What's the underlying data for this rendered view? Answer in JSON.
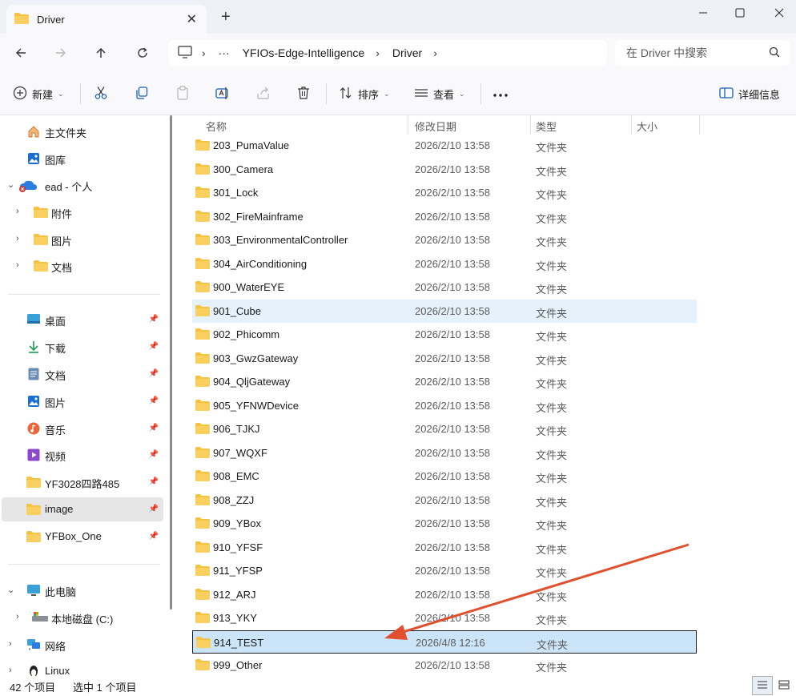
{
  "window": {
    "tab_title": "Driver",
    "colors": {
      "accent": "#0067c0",
      "folder": "#f5c242",
      "selected_row": "#cce4f7",
      "annotation_arrow": "#e0502e"
    }
  },
  "address": {
    "crumbs": [
      "YFIOs-Edge-Intelligence",
      "Driver"
    ],
    "search_placeholder": "在 Driver 中搜索"
  },
  "toolbar": {
    "new_label": "新建",
    "sort_label": "排序",
    "view_label": "查看",
    "details_label": "详细信息"
  },
  "sidebar": {
    "home": "主文件夹",
    "gallery": "图库",
    "onedrive": "ead - 个人",
    "od_attachments": "附件",
    "od_pictures": "图片",
    "od_documents": "文档",
    "desktop": "桌面",
    "downloads": "下载",
    "documents": "文档",
    "pictures": "图片",
    "music": "音乐",
    "videos": "视频",
    "pinned1": "YF3028四路485",
    "pinned2": "image",
    "pinned3": "YFBox_One",
    "thispc": "此电脑",
    "localdisk": "本地磁盘 (C:)",
    "network": "网络",
    "linux": "Linux"
  },
  "columns": {
    "name": "名称",
    "modified": "修改日期",
    "type": "类型",
    "size": "大小"
  },
  "files": [
    {
      "name": "203_PumaValue",
      "date": "2026/2/10 13:58",
      "type": "文件夹"
    },
    {
      "name": "300_Camera",
      "date": "2026/2/10 13:58",
      "type": "文件夹"
    },
    {
      "name": "301_Lock",
      "date": "2026/2/10 13:58",
      "type": "文件夹"
    },
    {
      "name": "302_FireMainframe",
      "date": "2026/2/10 13:58",
      "type": "文件夹"
    },
    {
      "name": "303_EnvironmentalController",
      "date": "2026/2/10 13:58",
      "type": "文件夹"
    },
    {
      "name": "304_AirConditioning",
      "date": "2026/2/10 13:58",
      "type": "文件夹"
    },
    {
      "name": "900_WaterEYE",
      "date": "2026/2/10 13:58",
      "type": "文件夹"
    },
    {
      "name": "901_Cube",
      "date": "2026/2/10 13:58",
      "type": "文件夹"
    },
    {
      "name": "902_Phicomm",
      "date": "2026/2/10 13:58",
      "type": "文件夹"
    },
    {
      "name": "903_GwzGateway",
      "date": "2026/2/10 13:58",
      "type": "文件夹"
    },
    {
      "name": "904_QljGateway",
      "date": "2026/2/10 13:58",
      "type": "文件夹"
    },
    {
      "name": "905_YFNWDevice",
      "date": "2026/2/10 13:58",
      "type": "文件夹"
    },
    {
      "name": "906_TJKJ",
      "date": "2026/2/10 13:58",
      "type": "文件夹"
    },
    {
      "name": "907_WQXF",
      "date": "2026/2/10 13:58",
      "type": "文件夹"
    },
    {
      "name": "908_EMC",
      "date": "2026/2/10 13:58",
      "type": "文件夹"
    },
    {
      "name": "908_ZZJ",
      "date": "2026/2/10 13:58",
      "type": "文件夹"
    },
    {
      "name": "909_YBox",
      "date": "2026/2/10 13:58",
      "type": "文件夹"
    },
    {
      "name": "910_YFSF",
      "date": "2026/2/10 13:58",
      "type": "文件夹"
    },
    {
      "name": "911_YFSP",
      "date": "2026/2/10 13:58",
      "type": "文件夹"
    },
    {
      "name": "912_ARJ",
      "date": "2026/2/10 13:58",
      "type": "文件夹"
    },
    {
      "name": "913_YKY",
      "date": "2026/2/10 13:58",
      "type": "文件夹"
    },
    {
      "name": "914_TEST",
      "date": "2026/4/8 12:16",
      "type": "文件夹"
    },
    {
      "name": "999_Other",
      "date": "2026/2/10 13:58",
      "type": "文件夹"
    }
  ],
  "status": {
    "item_count": "42 个项目",
    "selection": "选中 1 个项目"
  }
}
